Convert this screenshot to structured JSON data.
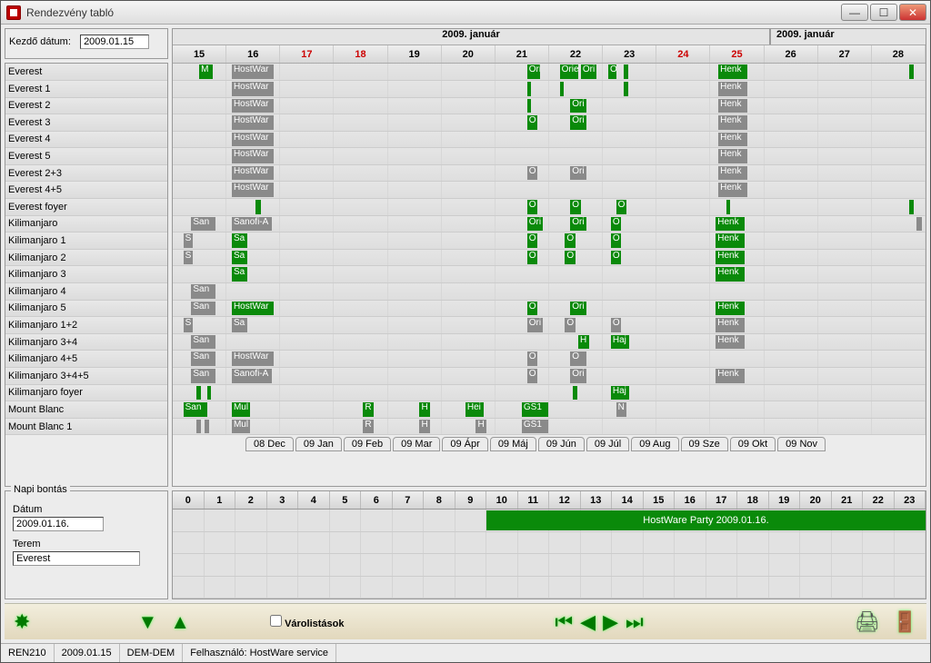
{
  "window": {
    "title": "Rendezvény tabló"
  },
  "start": {
    "label": "Kezdő dátum:",
    "value": "2009.01.15"
  },
  "schedule": {
    "months": {
      "left": "2009.  január",
      "right": "2009.  január"
    },
    "days": [
      {
        "n": "15",
        "wk": false
      },
      {
        "n": "16",
        "wk": false
      },
      {
        "n": "17",
        "wk": true
      },
      {
        "n": "18",
        "wk": true
      },
      {
        "n": "19",
        "wk": false
      },
      {
        "n": "20",
        "wk": false
      },
      {
        "n": "21",
        "wk": false
      },
      {
        "n": "22",
        "wk": false
      },
      {
        "n": "23",
        "wk": false
      },
      {
        "n": "24",
        "wk": true
      },
      {
        "n": "25",
        "wk": true
      },
      {
        "n": "26",
        "wk": false
      },
      {
        "n": "27",
        "wk": false
      },
      {
        "n": "28",
        "wk": false
      }
    ],
    "rooms": [
      {
        "name": "Everest",
        "bars": [
          {
            "d": 0,
            "l": "50%",
            "w": "25%",
            "c": "grn",
            "t": "M"
          },
          {
            "d": 1,
            "l": "10%",
            "w": "80%",
            "c": "gry",
            "t": "HostWar"
          },
          {
            "d": 6,
            "l": "60%",
            "w": "25%",
            "c": "grn",
            "t": "Ori"
          },
          {
            "d": 7,
            "l": "20%",
            "w": "35%",
            "c": "grn",
            "t": "Orie"
          },
          {
            "d": 7,
            "l": "60%",
            "w": "30%",
            "c": "grn",
            "t": "Ori"
          },
          {
            "d": 8,
            "l": "10%",
            "w": "15%",
            "c": "grn",
            "t": "O"
          },
          {
            "d": 8,
            "l": "40%",
            "w": "8%",
            "c": "grn",
            "t": ""
          },
          {
            "d": 10,
            "l": "15%",
            "w": "55%",
            "c": "grn",
            "t": "Henk"
          },
          {
            "d": 13,
            "l": "70%",
            "w": "10%",
            "c": "grn",
            "t": ""
          }
        ]
      },
      {
        "name": "Everest 1",
        "bars": [
          {
            "d": 1,
            "l": "10%",
            "w": "80%",
            "c": "gry",
            "t": "HostWar"
          },
          {
            "d": 6,
            "l": "60%",
            "w": "8%",
            "c": "grn",
            "t": ""
          },
          {
            "d": 7,
            "l": "20%",
            "w": "8%",
            "c": "grn",
            "t": ""
          },
          {
            "d": 8,
            "l": "40%",
            "w": "8%",
            "c": "grn",
            "t": ""
          },
          {
            "d": 10,
            "l": "15%",
            "w": "55%",
            "c": "gry",
            "t": "Henk"
          }
        ]
      },
      {
        "name": "Everest 2",
        "bars": [
          {
            "d": 1,
            "l": "10%",
            "w": "80%",
            "c": "gry",
            "t": "HostWar"
          },
          {
            "d": 6,
            "l": "60%",
            "w": "8%",
            "c": "grn",
            "t": ""
          },
          {
            "d": 7,
            "l": "40%",
            "w": "30%",
            "c": "grn",
            "t": "Ori"
          },
          {
            "d": 10,
            "l": "15%",
            "w": "55%",
            "c": "gry",
            "t": "Henk"
          }
        ]
      },
      {
        "name": "Everest 3",
        "bars": [
          {
            "d": 1,
            "l": "10%",
            "w": "80%",
            "c": "gry",
            "t": "HostWar"
          },
          {
            "d": 6,
            "l": "60%",
            "w": "20%",
            "c": "grn",
            "t": "O"
          },
          {
            "d": 7,
            "l": "40%",
            "w": "30%",
            "c": "grn",
            "t": "Ori"
          },
          {
            "d": 10,
            "l": "15%",
            "w": "55%",
            "c": "gry",
            "t": "Henk"
          }
        ]
      },
      {
        "name": "Everest 4",
        "bars": [
          {
            "d": 1,
            "l": "10%",
            "w": "80%",
            "c": "gry",
            "t": "HostWar"
          },
          {
            "d": 10,
            "l": "15%",
            "w": "55%",
            "c": "gry",
            "t": "Henk"
          }
        ]
      },
      {
        "name": "Everest 5",
        "bars": [
          {
            "d": 1,
            "l": "10%",
            "w": "80%",
            "c": "gry",
            "t": "HostWar"
          },
          {
            "d": 10,
            "l": "15%",
            "w": "55%",
            "c": "gry",
            "t": "Henk"
          }
        ]
      },
      {
        "name": "Everest 2+3",
        "bars": [
          {
            "d": 1,
            "l": "10%",
            "w": "80%",
            "c": "gry",
            "t": "HostWar"
          },
          {
            "d": 6,
            "l": "60%",
            "w": "20%",
            "c": "gry",
            "t": "O"
          },
          {
            "d": 7,
            "l": "40%",
            "w": "30%",
            "c": "gry",
            "t": "Ori"
          },
          {
            "d": 10,
            "l": "15%",
            "w": "55%",
            "c": "gry",
            "t": "Henk"
          }
        ]
      },
      {
        "name": "Everest 4+5",
        "bars": [
          {
            "d": 1,
            "l": "10%",
            "w": "80%",
            "c": "gry",
            "t": "HostWar"
          },
          {
            "d": 10,
            "l": "15%",
            "w": "55%",
            "c": "gry",
            "t": "Henk"
          }
        ]
      },
      {
        "name": "Everest foyer",
        "bars": [
          {
            "d": 1,
            "l": "55%",
            "w": "10%",
            "c": "grn",
            "t": ""
          },
          {
            "d": 6,
            "l": "60%",
            "w": "20%",
            "c": "grn",
            "t": "O"
          },
          {
            "d": 7,
            "l": "40%",
            "w": "20%",
            "c": "grn",
            "t": "O"
          },
          {
            "d": 8,
            "l": "25%",
            "w": "20%",
            "c": "grn",
            "t": "O"
          },
          {
            "d": 10,
            "l": "30%",
            "w": "8%",
            "c": "grn",
            "t": ""
          },
          {
            "d": 13,
            "l": "70%",
            "w": "10%",
            "c": "grn",
            "t": ""
          }
        ]
      },
      {
        "name": "Kilimanjaro",
        "bars": [
          {
            "d": 0,
            "l": "35%",
            "w": "45%",
            "c": "gry",
            "t": "San"
          },
          {
            "d": 1,
            "l": "10%",
            "w": "75%",
            "c": "gry",
            "t": "Sanofi-A"
          },
          {
            "d": 6,
            "l": "60%",
            "w": "30%",
            "c": "grn",
            "t": "Ori"
          },
          {
            "d": 7,
            "l": "40%",
            "w": "30%",
            "c": "grn",
            "t": "Ori"
          },
          {
            "d": 8,
            "l": "15%",
            "w": "20%",
            "c": "grn",
            "t": "O"
          },
          {
            "d": 10,
            "l": "10%",
            "w": "55%",
            "c": "grn",
            "t": "Henk"
          },
          {
            "d": 13,
            "l": "85%",
            "w": "10%",
            "c": "gry",
            "t": ""
          }
        ]
      },
      {
        "name": "Kilimanjaro 1",
        "bars": [
          {
            "d": 0,
            "l": "20%",
            "w": "18%",
            "c": "gry",
            "t": "S"
          },
          {
            "d": 1,
            "l": "10%",
            "w": "30%",
            "c": "grn",
            "t": "Sa"
          },
          {
            "d": 6,
            "l": "60%",
            "w": "20%",
            "c": "grn",
            "t": "O"
          },
          {
            "d": 7,
            "l": "30%",
            "w": "20%",
            "c": "grn",
            "t": "O"
          },
          {
            "d": 8,
            "l": "15%",
            "w": "20%",
            "c": "grn",
            "t": "O"
          },
          {
            "d": 10,
            "l": "10%",
            "w": "55%",
            "c": "grn",
            "t": "Henk"
          }
        ]
      },
      {
        "name": "Kilimanjaro 2",
        "bars": [
          {
            "d": 0,
            "l": "20%",
            "w": "18%",
            "c": "gry",
            "t": "S"
          },
          {
            "d": 1,
            "l": "10%",
            "w": "30%",
            "c": "grn",
            "t": "Sa"
          },
          {
            "d": 6,
            "l": "60%",
            "w": "20%",
            "c": "grn",
            "t": "O"
          },
          {
            "d": 7,
            "l": "30%",
            "w": "20%",
            "c": "grn",
            "t": "O"
          },
          {
            "d": 8,
            "l": "15%",
            "w": "20%",
            "c": "grn",
            "t": "O"
          },
          {
            "d": 10,
            "l": "10%",
            "w": "55%",
            "c": "grn",
            "t": "Henk"
          }
        ]
      },
      {
        "name": "Kilimanjaro 3",
        "bars": [
          {
            "d": 1,
            "l": "10%",
            "w": "30%",
            "c": "grn",
            "t": "Sa"
          },
          {
            "d": 10,
            "l": "10%",
            "w": "55%",
            "c": "grn",
            "t": "Henk"
          }
        ]
      },
      {
        "name": "Kilimanjaro 4",
        "bars": [
          {
            "d": 0,
            "l": "35%",
            "w": "45%",
            "c": "gry",
            "t": "San"
          }
        ]
      },
      {
        "name": "Kilimanjaro 5",
        "bars": [
          {
            "d": 0,
            "l": "35%",
            "w": "45%",
            "c": "gry",
            "t": "San"
          },
          {
            "d": 1,
            "l": "10%",
            "w": "80%",
            "c": "grn",
            "t": "HostWar"
          },
          {
            "d": 6,
            "l": "60%",
            "w": "20%",
            "c": "grn",
            "t": "O"
          },
          {
            "d": 7,
            "l": "40%",
            "w": "30%",
            "c": "grn",
            "t": "Ori"
          },
          {
            "d": 10,
            "l": "10%",
            "w": "55%",
            "c": "grn",
            "t": "Henk"
          }
        ]
      },
      {
        "name": "Kilimanjaro 1+2",
        "bars": [
          {
            "d": 0,
            "l": "20%",
            "w": "18%",
            "c": "gry",
            "t": "S"
          },
          {
            "d": 1,
            "l": "10%",
            "w": "30%",
            "c": "gry",
            "t": "Sa"
          },
          {
            "d": 6,
            "l": "60%",
            "w": "30%",
            "c": "gry",
            "t": "Ori"
          },
          {
            "d": 7,
            "l": "30%",
            "w": "20%",
            "c": "gry",
            "t": "O"
          },
          {
            "d": 8,
            "l": "15%",
            "w": "20%",
            "c": "gry",
            "t": "O"
          },
          {
            "d": 10,
            "l": "10%",
            "w": "55%",
            "c": "gry",
            "t": "Henk"
          }
        ]
      },
      {
        "name": "Kilimanjaro 3+4",
        "bars": [
          {
            "d": 0,
            "l": "35%",
            "w": "45%",
            "c": "gry",
            "t": "San"
          },
          {
            "d": 7,
            "l": "55%",
            "w": "20%",
            "c": "grn",
            "t": "H"
          },
          {
            "d": 8,
            "l": "15%",
            "w": "35%",
            "c": "grn",
            "t": "Haj"
          },
          {
            "d": 10,
            "l": "10%",
            "w": "55%",
            "c": "gry",
            "t": "Henk"
          }
        ]
      },
      {
        "name": "Kilimanjaro 4+5",
        "bars": [
          {
            "d": 0,
            "l": "35%",
            "w": "45%",
            "c": "gry",
            "t": "San"
          },
          {
            "d": 1,
            "l": "10%",
            "w": "80%",
            "c": "gry",
            "t": "HostWar"
          },
          {
            "d": 6,
            "l": "60%",
            "w": "20%",
            "c": "gry",
            "t": "O"
          },
          {
            "d": 7,
            "l": "40%",
            "w": 30,
            "c": "gry",
            "t": "O"
          }
        ]
      },
      {
        "name": "Kilimanjaro 3+4+5",
        "bars": [
          {
            "d": 0,
            "l": "35%",
            "w": "45%",
            "c": "gry",
            "t": "San"
          },
          {
            "d": 1,
            "l": "10%",
            "w": "75%",
            "c": "gry",
            "t": "Sanofi-A"
          },
          {
            "d": 6,
            "l": "60%",
            "w": "20%",
            "c": "gry",
            "t": "O"
          },
          {
            "d": 7,
            "l": "40%",
            "w": "30%",
            "c": "gry",
            "t": "Ori"
          },
          {
            "d": 10,
            "l": "10%",
            "w": "55%",
            "c": "gry",
            "t": "Henk"
          }
        ]
      },
      {
        "name": "Kilimanjaro foyer",
        "bars": [
          {
            "d": 0,
            "l": "45%",
            "w": "8%",
            "c": "grn",
            "t": ""
          },
          {
            "d": 0,
            "l": "65%",
            "w": "8%",
            "c": "grn",
            "t": ""
          },
          {
            "d": 7,
            "l": "45%",
            "w": "8%",
            "c": "grn",
            "t": ""
          },
          {
            "d": 8,
            "l": "15%",
            "w": "35%",
            "c": "grn",
            "t": "Haj"
          }
        ]
      },
      {
        "name": "Mount Blanc",
        "bars": [
          {
            "d": 0,
            "l": "20%",
            "w": "45%",
            "c": "grn",
            "t": "San"
          },
          {
            "d": 1,
            "l": "10%",
            "w": "35%",
            "c": "grn",
            "t": "Mul"
          },
          {
            "d": 3,
            "l": "55%",
            "w": "20%",
            "c": "grn",
            "t": "R"
          },
          {
            "d": 4,
            "l": "60%",
            "w": "20%",
            "c": "grn",
            "t": "H"
          },
          {
            "d": 5,
            "l": "45%",
            "w": "35%",
            "c": "grn",
            "t": "Hei"
          },
          {
            "d": 6,
            "l": "50%",
            "w": "50%",
            "c": "grn",
            "t": "GS1"
          },
          {
            "d": 8,
            "l": "25%",
            "w": "20%",
            "c": "gry",
            "t": "N"
          }
        ]
      },
      {
        "name": "Mount Blanc 1",
        "bars": [
          {
            "d": 0,
            "l": "45%",
            "w": "8%",
            "c": "gry",
            "t": ""
          },
          {
            "d": 0,
            "l": "60%",
            "w": "8%",
            "c": "gry",
            "t": ""
          },
          {
            "d": 1,
            "l": "10%",
            "w": "35%",
            "c": "gry",
            "t": "Mul"
          },
          {
            "d": 3,
            "l": "55%",
            "w": "20%",
            "c": "gry",
            "t": "R"
          },
          {
            "d": 4,
            "l": "60%",
            "w": "20%",
            "c": "gry",
            "t": "H"
          },
          {
            "d": 5,
            "l": "65%",
            "w": "20%",
            "c": "gry",
            "t": "H"
          },
          {
            "d": 6,
            "l": "50%",
            "w": "50%",
            "c": "gry",
            "t": "GS1"
          }
        ]
      }
    ]
  },
  "monthTabs": [
    "08 Dec",
    "09 Jan",
    "09 Feb",
    "09 Mar",
    "09 Ápr",
    "09 Máj",
    "09 Jún",
    "09 Júl",
    "09 Aug",
    "09 Sze",
    "09 Okt",
    "09 Nov"
  ],
  "napi": {
    "legend": "Napi bontás",
    "dateLabel": "Dátum",
    "dateValue": "2009.01.16.",
    "roomLabel": "Terem",
    "roomValue": "Everest"
  },
  "hours": [
    "0",
    "1",
    "2",
    "3",
    "4",
    "5",
    "6",
    "7",
    "8",
    "9",
    "10",
    "11",
    "12",
    "13",
    "14",
    "15",
    "16",
    "17",
    "18",
    "19",
    "20",
    "21",
    "22",
    "23"
  ],
  "bottomEvent": {
    "label": "HostWare Party 2009.01.16.",
    "startHour": 10,
    "endHour": 24
  },
  "toolbar": {
    "varolist": "Várolistások"
  },
  "status": {
    "code": "REN210",
    "date": "2009.01.15",
    "group": "DEM-DEM",
    "user": "Felhasználó: HostWare service"
  }
}
